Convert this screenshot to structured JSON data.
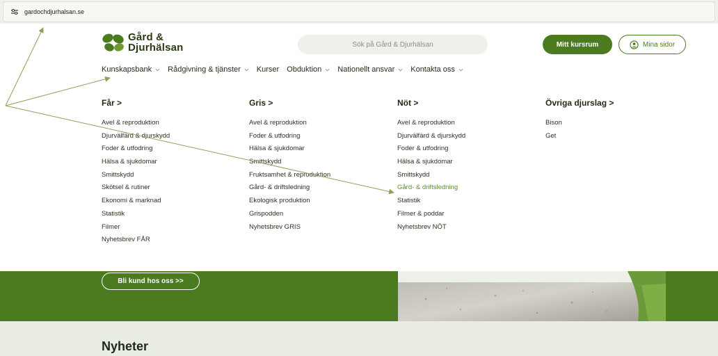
{
  "browser": {
    "url": "gardochdjurhalsan.se",
    "site_icon": "tune-icon"
  },
  "header": {
    "logo_line1": "Gård &",
    "logo_line2": "Djurhälsan",
    "search_placeholder": "Sök på Gård & Djurhälsan",
    "course_button": "Mitt kursrum",
    "pages_button": "Mina sidor"
  },
  "nav": {
    "items": [
      {
        "label": "Kunskapsbank",
        "has_dropdown": true
      },
      {
        "label": "Rådgivning & tjänster",
        "has_dropdown": true
      },
      {
        "label": "Kurser",
        "has_dropdown": false
      },
      {
        "label": "Obduktion",
        "has_dropdown": true
      },
      {
        "label": "Nationellt ansvar",
        "has_dropdown": true
      },
      {
        "label": "Kontakta oss",
        "has_dropdown": true
      }
    ]
  },
  "menu": {
    "columns": [
      {
        "title": "Får >",
        "items": [
          "Avel & reproduktion",
          "Djurvälfärd & djurskydd",
          "Foder & utfodring",
          "Hälsa & sjukdomar",
          "Smittskydd",
          "Skötsel & rutiner",
          "Ekonomi & marknad",
          "Statistik",
          "Filmer",
          "Nyhetsbrev FÅR"
        ]
      },
      {
        "title": "Gris >",
        "items": [
          "Avel & reproduktion",
          "Foder & utfodring",
          "Hälsa & sjukdomar",
          "Smittskydd",
          "Fruktsamhet & reproduktion",
          "Gård- & driftsledning",
          "Ekologisk produktion",
          "Grispodden",
          "Nyhetsbrev GRIS"
        ]
      },
      {
        "title": "Nöt >",
        "items": [
          "Avel & reproduktion",
          "Djurvälfärd & djurskydd",
          "Foder & utfodring",
          "Hälsa & sjukdomar",
          "Smittskydd",
          "Gård- & driftsledning",
          "Statistik",
          "Filmer & poddar",
          "Nyhetsbrev NÖT"
        ],
        "active_item": "Gård- & driftsledning"
      },
      {
        "title": "Övriga djurslag >",
        "items": [
          "Bison",
          "Get"
        ]
      }
    ]
  },
  "hero": {
    "cta": "Bli kund hos oss >>"
  },
  "news": {
    "title": "Nyheter"
  },
  "colors": {
    "brand_green": "#4c7a1f",
    "active_link": "#5f8f24",
    "annotation_arrow": "#8aa35a"
  }
}
